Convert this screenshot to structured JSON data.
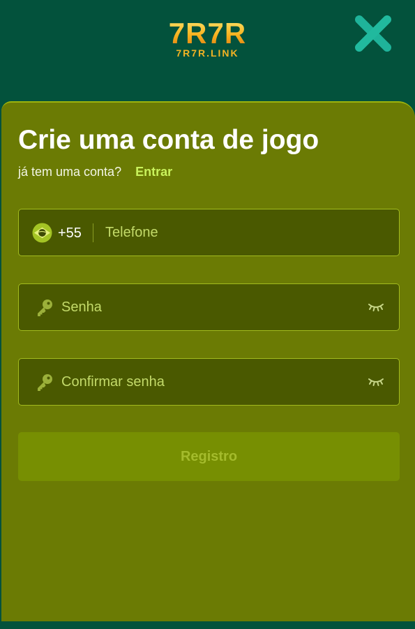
{
  "header": {
    "logo_main": "7R7R",
    "logo_sub": "7R7R.LINK",
    "close_icon": "close-x-icon"
  },
  "form": {
    "title": "Crie uma conta de jogo",
    "subtitle": "já tem uma conta?",
    "login_link": "Entrar",
    "phone": {
      "country_icon": "brazil-flag-icon",
      "country_code": "+55",
      "placeholder": "Telefone",
      "value": ""
    },
    "password": {
      "icon": "key-icon",
      "placeholder": "Senha",
      "value": "",
      "toggle_icon": "eye-closed-icon"
    },
    "confirm_password": {
      "icon": "key-icon",
      "placeholder": "Confirmar senha",
      "value": "",
      "toggle_icon": "eye-closed-icon"
    },
    "submit_label": "Registro"
  },
  "colors": {
    "background": "#03523c",
    "panel": "#6b7b04",
    "field_bg": "#4a5900",
    "field_border": "#a2bb1e",
    "accent_link": "#c9f25c",
    "logo_gold": "#f7b21f",
    "close_icon": "#1fb39a",
    "button_bg": "#778f02",
    "button_text": "#a4bb2c"
  }
}
